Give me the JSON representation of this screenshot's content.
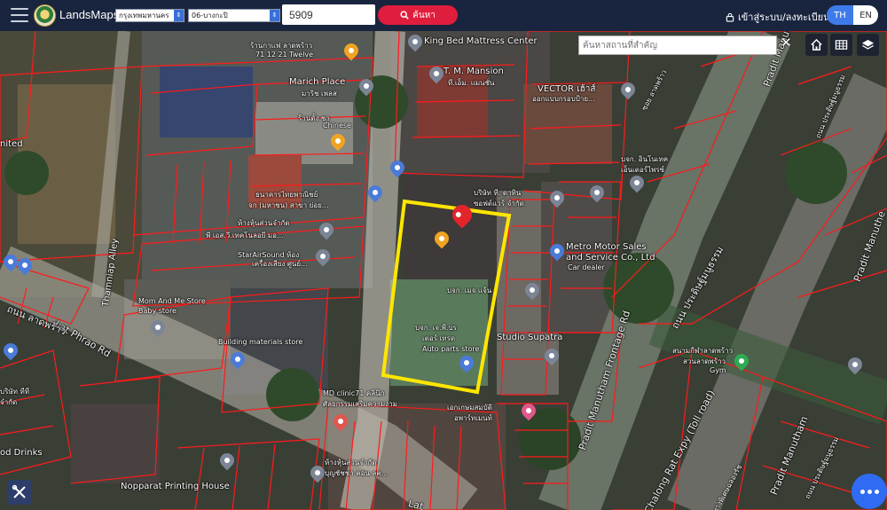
{
  "app": {
    "name": "LandsMaps"
  },
  "filters": {
    "province": "กรุงเทพมหานคร",
    "district": "06-บางกะปิ",
    "parcel_number": "5909"
  },
  "search_button": "ค้นหา",
  "login_link": "เข้าสู่ระบบ/ลงทะเบียน",
  "language": {
    "th": "TH",
    "en": "EN",
    "selected": "TH"
  },
  "poi_search": {
    "placeholder": "ค้นหาสถานที่สำคัญ"
  },
  "map_labels": {
    "king_bed": "King Bed Mattress Center",
    "cafe": "ร้านกาแฟ ลาดพร้าว",
    "cafe2": "71 12 21 Twelve",
    "tm_mansion": "T. M. Mansion",
    "tm_mansion_th": "ที.เอ็ม. แมนชั่น",
    "vector": "VECTOR เฮ้าส์",
    "vector2": "ออกแบบกรอบป้าย...",
    "marich": "Marich Place",
    "marich_th": "มาริช เพลส",
    "chinese": "ร้านตั้ง ชา",
    "chinese2": "Chinese",
    "ladphrao_road_th": "ซอย ลาดพร้าว",
    "thamniap": "Thamniap Alley",
    "bank": "ธนาคารไทยพาณิชย์",
    "bank2": "จก (มหาชน) สาขา ย่อย...",
    "company_a": "บริษัท ที. ดาทิน",
    "company_a2": "ซอฟต์แวร์ จำกัด",
    "interfood": "บจก. อินโนเทค",
    "interfood2": "เอ็นเตอร์ไพรซ์",
    "shop_pl": "ห้างหุ้นส่วนจำกัด",
    "shop_pl2": "พี เอส.วี.เทคโนลอยี มอ...",
    "starair": "StarAirSound ห้อง",
    "starair2": "เครื่องเสียง ศูนย์...",
    "metro": "Metro Motor Sales",
    "metro2": "and Service Co., Ltd",
    "metro3": "Car dealer",
    "manutham_th": "ถนน ประดิษฐ์มนูธรรม",
    "lat_phrao_rd": "Lat Phrao Rd",
    "lat_phrao_th": "ถนน ลาดพร้าว",
    "mom": "Mom And Me Store",
    "mom2": "Baby store",
    "company_b": "บจก. เมจ แจ้น",
    "company_c": "บจก. เจ.พี.บร",
    "company_c2": "เตอร์ เทรด",
    "auto_parts": "Auto parts store",
    "studio": "Studio Supatra",
    "frontage": "Pradit Manutham Frontage Rd",
    "building_mat": "Building materials store",
    "stadium": "สนามกีฬาลาดพร้าว",
    "stadium2": "สวนลาดพร้าว",
    "gym": "Gym",
    "md_clinic": "MD clinic71 คลินิก",
    "md_clinic2": "ศัลยกรรมเสริมความงาม",
    "health": "เอกเกษมสมบัติ",
    "health2": "อพาร์ทเมนท์",
    "ramintra": "Pradit Manutham",
    "ramintra_th": "ถนน ประดิษฐ์มนูธรรม",
    "expwy": "Chalong Rat Expy (Toll road)",
    "expwy_th": "ทางพิเศษฉลองรัช",
    "pradit": "Pradit Manutham",
    "pradit_th": "ถนน ประดิษฐ์มนูธรรม",
    "pradit_right": "Pradit Manuthe",
    "printing": "Nopparat Printing House",
    "printing_th": "ห้างหุ้นส่วนจำกัด",
    "printing_th2": "บุญชัชชา คอน ลค...",
    "drinks": "od Drinks",
    "left_jd": "บริษัท ทีที",
    "left_jd2": "จำกัด",
    "nited": "nited",
    "lat_bottom": "Lat"
  },
  "colors": {
    "topbar": "#19253f",
    "search_button": "#e01d3c",
    "lang_selected": "#3e7bea",
    "parcel_lines": "#ff1a1a",
    "selected_parcel": "#ffe600",
    "chat_button": "#2f6cf3"
  },
  "icons": {
    "menu": "hamburger-icon",
    "search": "search-icon",
    "login": "lock-icon",
    "home": "home-icon",
    "grid": "grid-icon",
    "layers": "layers-icon",
    "tools": "tools-icon",
    "chat": "chat-icon"
  }
}
